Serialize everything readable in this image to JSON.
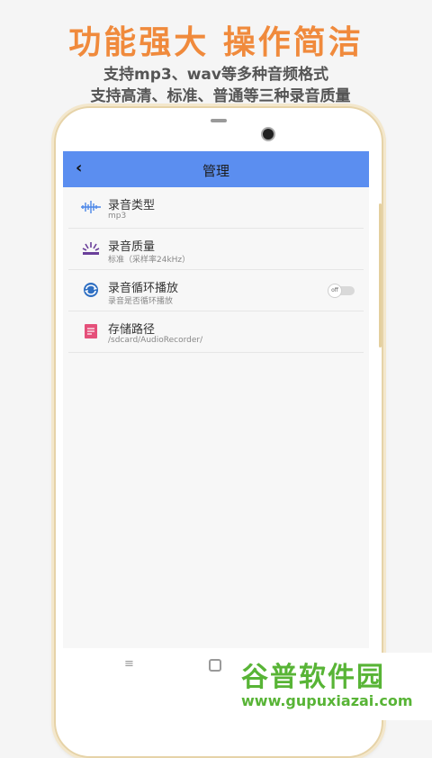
{
  "promo": {
    "headline": "功能强大 操作简洁",
    "line1": "支持mp3、wav等多种音频格式",
    "line2": "支持高清、标准、普通等三种录音质量"
  },
  "appbar": {
    "back_icon": "‹",
    "title": "管理"
  },
  "settings": [
    {
      "title": "录音类型",
      "subtitle": "mp3",
      "icon": "waveform-icon"
    },
    {
      "title": "录音质量",
      "subtitle": "标准（采样率24kHz）",
      "icon": "quality-icon"
    },
    {
      "title": "录音循环播放",
      "subtitle": "录音是否循环播放",
      "icon": "loop-icon",
      "toggle": "off"
    },
    {
      "title": "存储路径",
      "subtitle": "/sdcard/AudioRecorder/",
      "icon": "folder-icon"
    }
  ],
  "navbar": {
    "menu_glyph": "≡"
  },
  "watermark": {
    "top": "谷普软件园",
    "bottom": "www.gupuxiazai.com"
  },
  "colors": {
    "headline": "#f08a3c",
    "appbar": "#5b8ef0",
    "watermark": "#58b436"
  }
}
